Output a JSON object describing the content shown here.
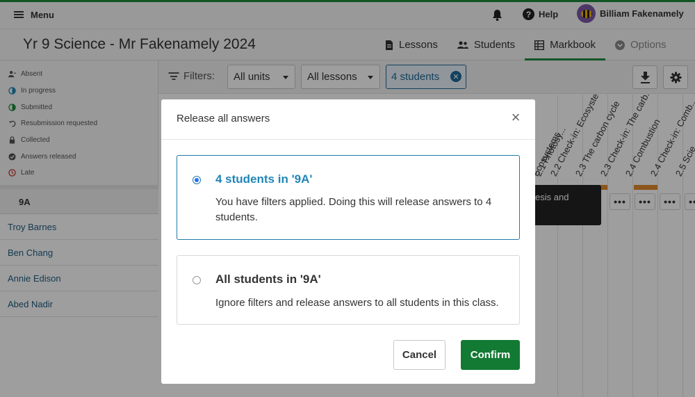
{
  "topbar": {
    "menu_label": "Menu",
    "help_label": "Help",
    "user_name": "Billiam Fakenamely"
  },
  "header": {
    "page_title": "Yr 9 Science - Mr Fakenamely 2024",
    "tabs": [
      {
        "label": "Lessons",
        "icon": "document-icon",
        "state": "normal"
      },
      {
        "label": "Students",
        "icon": "people-icon",
        "state": "normal"
      },
      {
        "label": "Markbook",
        "icon": "grid-icon",
        "state": "active"
      },
      {
        "label": "Options",
        "icon": "chevron-circle-icon",
        "state": "disabled"
      }
    ]
  },
  "legend": [
    {
      "label": "Absent",
      "icon": "person-remove-icon"
    },
    {
      "label": "In progress",
      "icon": "half-circle-icon"
    },
    {
      "label": "Submitted",
      "icon": "submitted-circle-icon"
    },
    {
      "label": "Resubmission requested",
      "icon": "undo-icon"
    },
    {
      "label": "Collected",
      "icon": "lock-icon"
    },
    {
      "label": "Answers released",
      "icon": "check-circle-icon"
    },
    {
      "label": "Late",
      "icon": "clock-icon"
    }
  ],
  "class_group": {
    "name": "9A",
    "students": [
      "Troy Barnes",
      "Ben Chang",
      "Annie Edison",
      "Abed Nadir"
    ]
  },
  "filters": {
    "label": "Filters:",
    "units_dropdown": "All units",
    "lessons_dropdown": "All lessons",
    "students_chip": "4 students"
  },
  "lesson_columns": [
    "2.1 Photosy...",
    "Ecosystems",
    "2.2 Check-in: Ecosyste...",
    "2.3 The carbon cycle",
    "2.3 Check-in: The carb...",
    "2.4 Combustion",
    "2.4 Check-in: Comb...",
    "2.5 Scie..."
  ],
  "tooltip_text": "esis and",
  "modal": {
    "title": "Release all answers",
    "options": [
      {
        "title": "4 students in '9A'",
        "description": "You have filters applied. Doing this will release answers to 4 students.",
        "selected": true
      },
      {
        "title": "All students in '9A'",
        "description": "Ignore filters and release answers to all students in this class.",
        "selected": false
      }
    ],
    "cancel_label": "Cancel",
    "confirm_label": "Confirm"
  },
  "colors": {
    "accent_green": "#1e8a3c",
    "confirm_green": "#137a33",
    "selected_blue": "#1f86b8",
    "link_blue": "#1f5d82",
    "orange_marker": "#e08a2c"
  }
}
